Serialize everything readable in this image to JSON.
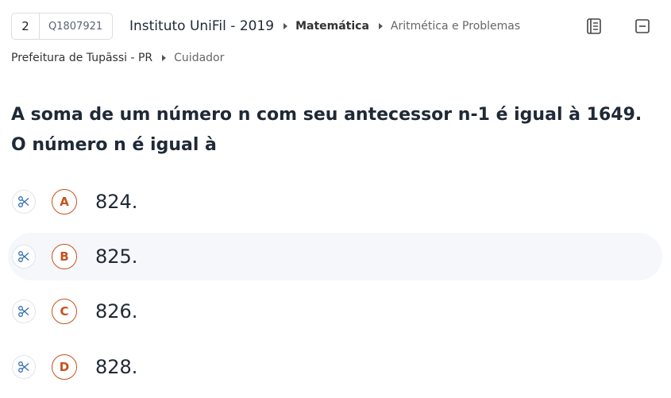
{
  "header": {
    "number": "2",
    "question_id": "Q1807921",
    "institution": "Instituto UniFil - 2019",
    "subject": "Matemática",
    "topic": "Aritmética e Problemas",
    "organization": "Prefeitura de Tupãssi - PR",
    "role": "Cuidador"
  },
  "toolbar": {
    "notebook_icon": "notebook-icon",
    "collapse_icon": "minus-square-icon"
  },
  "statement": "A soma de um número n com seu antecessor n-1 é igual à 1649. O número n é igual à",
  "alternatives": [
    {
      "letter": "A",
      "text": "824."
    },
    {
      "letter": "B",
      "text": "825."
    },
    {
      "letter": "C",
      "text": "826."
    },
    {
      "letter": "D",
      "text": "828."
    }
  ],
  "colors": {
    "accent": "#c4521e",
    "scissor": "#2f6fb0",
    "hover_row": "#f5f7fa"
  }
}
